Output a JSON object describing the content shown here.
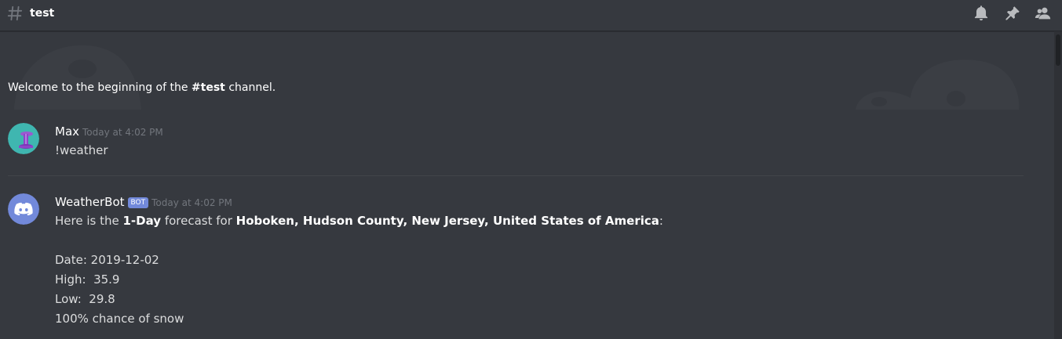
{
  "header": {
    "channel_name": "test",
    "icons": [
      "hash-icon",
      "bell-icon",
      "pin-icon",
      "members-icon"
    ]
  },
  "welcome": {
    "prefix": "Welcome to the beginning of the ",
    "channel": "#test",
    "suffix": " channel."
  },
  "messages": [
    {
      "author": "Max",
      "timestamp": "Today at 4:02 PM",
      "text": "!weather"
    },
    {
      "author": "WeatherBot",
      "bot_tag": "BOT",
      "timestamp": "Today at 4:02 PM",
      "intro_prefix": "Here is the ",
      "intro_bold_1": "1-Day",
      "intro_middle": " forecast for ",
      "intro_bold_2": "Hoboken, Hudson County, New Jersey, United States of America",
      "intro_suffix": ":",
      "date_line": "Date: 2019-12-02",
      "high_line": "High:  35.9",
      "low_line": "Low:  29.8",
      "snow_line": "100% chance of snow"
    }
  ],
  "colors": {
    "background": "#36393f",
    "bot_tag": "#7289da",
    "timestamp": "#72767d",
    "text": "#dcddde"
  }
}
